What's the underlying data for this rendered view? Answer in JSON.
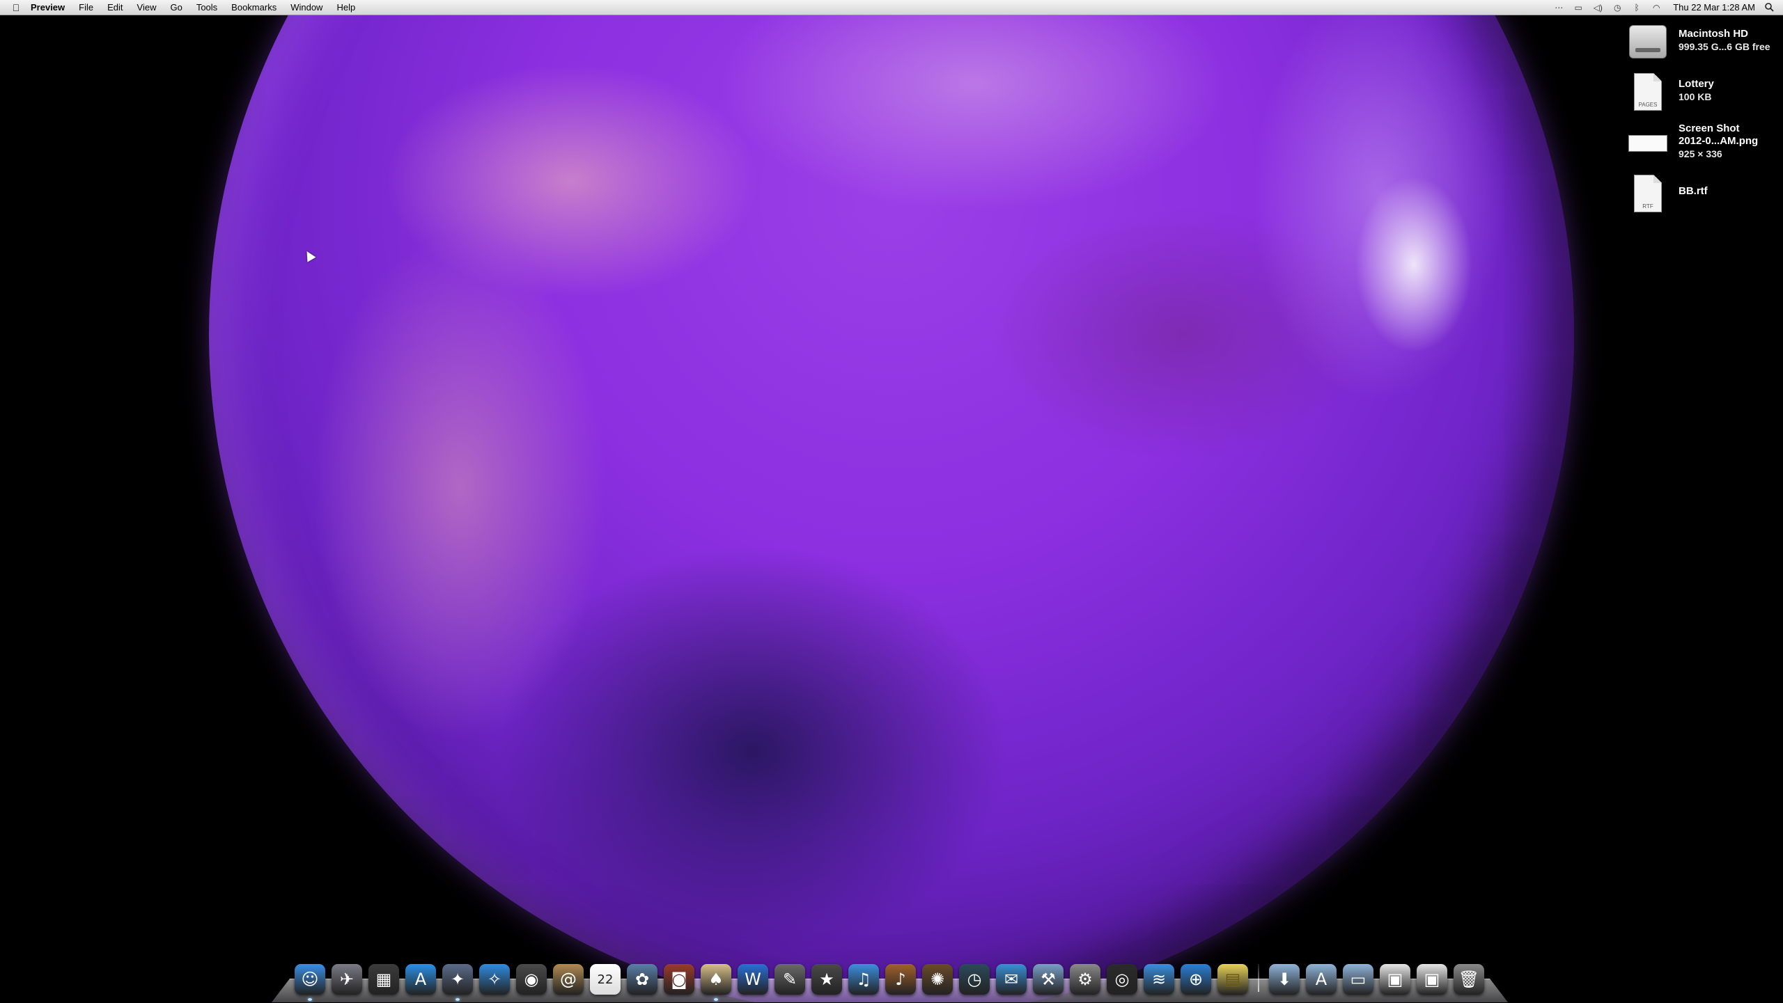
{
  "menubar": {
    "app_name": "Preview",
    "menus": [
      "File",
      "Edit",
      "View",
      "Go",
      "Tools",
      "Bookmarks",
      "Window",
      "Help"
    ],
    "clock": "Thu 22 Mar  1:28 AM"
  },
  "desktop_icons": [
    {
      "name": "Macintosh HD",
      "sub": "999.35 G...6 GB free",
      "icon": "hard-drive-icon"
    },
    {
      "name": "Lottery",
      "sub": "100 KB",
      "icon": "pages-document-icon",
      "tag": "PAGES"
    },
    {
      "name": "Screen Shot",
      "name2": "2012-0...AM.png",
      "sub": "925 × 336",
      "icon": "image-file-icon"
    },
    {
      "name": "BB.rtf",
      "sub": "",
      "icon": "rtf-document-icon",
      "tag": "RTF"
    }
  ],
  "dock": {
    "apps": [
      {
        "id": "finder",
        "icon": "finder-icon",
        "glyph": "☺",
        "color": "#3a8ee6",
        "running": true
      },
      {
        "id": "launchpad",
        "icon": "launchpad-icon",
        "glyph": "✈",
        "color": "#7b7b86",
        "running": false
      },
      {
        "id": "mission-control",
        "icon": "mission-control-icon",
        "glyph": "▦",
        "color": "#3b3b3b",
        "running": false
      },
      {
        "id": "app-store",
        "icon": "app-store-icon",
        "glyph": "A",
        "color": "#2b8fe6",
        "running": false
      },
      {
        "id": "preview",
        "icon": "preview-icon",
        "glyph": "✦",
        "color": "#5b6c8a",
        "running": true
      },
      {
        "id": "safari",
        "icon": "safari-icon",
        "glyph": "✧",
        "color": "#2f8be0",
        "running": false
      },
      {
        "id": "facetime",
        "icon": "facetime-icon",
        "glyph": "◉",
        "color": "#4a4a4a",
        "running": false
      },
      {
        "id": "address-book",
        "icon": "address-book-icon",
        "glyph": "@",
        "color": "#b08a52",
        "running": false
      },
      {
        "id": "ical",
        "icon": "ical-icon",
        "glyph": "22",
        "color": "#e94b4b",
        "running": false
      },
      {
        "id": "iphoto",
        "icon": "iphoto-icon",
        "glyph": "✿",
        "color": "#5a7fa8",
        "running": false
      },
      {
        "id": "photo-booth",
        "icon": "photo-booth-icon",
        "glyph": "◙",
        "color": "#9a3b2b",
        "running": false
      },
      {
        "id": "solitaire",
        "icon": "solitaire-icon",
        "glyph": "♠",
        "color": "#d9c08a",
        "running": true
      },
      {
        "id": "word",
        "icon": "word-icon",
        "glyph": "W",
        "color": "#2a6fd6",
        "running": false
      },
      {
        "id": "script-editor",
        "icon": "script-editor-icon",
        "glyph": "✎",
        "color": "#6a6a6a",
        "running": false
      },
      {
        "id": "imovie",
        "icon": "imovie-icon",
        "glyph": "★",
        "color": "#4a4a4a",
        "running": false
      },
      {
        "id": "itunes",
        "icon": "itunes-icon",
        "glyph": "♫",
        "color": "#3c8fe0",
        "running": false
      },
      {
        "id": "garageband",
        "icon": "garageband-icon",
        "glyph": "♪",
        "color": "#a0622b",
        "running": false
      },
      {
        "id": "pinata",
        "icon": "pinata-icon",
        "glyph": "✺",
        "color": "#6b4b2b",
        "running": false
      },
      {
        "id": "time-machine",
        "icon": "time-machine-icon",
        "glyph": "◷",
        "color": "#2b4b5b",
        "running": false
      },
      {
        "id": "mail",
        "icon": "mail-icon",
        "glyph": "✉",
        "color": "#3a8fd6",
        "running": false
      },
      {
        "id": "xcode",
        "icon": "xcode-icon",
        "glyph": "⚒",
        "color": "#7a9fc6",
        "running": false
      },
      {
        "id": "system-preferences",
        "icon": "system-preferences-icon",
        "glyph": "⚙",
        "color": "#8a8a8a",
        "running": false
      },
      {
        "id": "aperture",
        "icon": "aperture-icon",
        "glyph": "◎",
        "color": "#2b2b2b",
        "running": false
      },
      {
        "id": "wifi",
        "icon": "wifi-icon",
        "glyph": "≋",
        "color": "#3a8fe0",
        "running": false
      },
      {
        "id": "network",
        "icon": "network-globe-icon",
        "glyph": "⊕",
        "color": "#2b7fd6",
        "running": false
      },
      {
        "id": "stickies",
        "icon": "stickies-icon",
        "glyph": "▤",
        "color": "#e8d25a",
        "running": false
      }
    ],
    "stacks": [
      {
        "id": "downloads",
        "icon": "downloads-folder-icon",
        "glyph": "⬇",
        "color": "#8fb3d9"
      },
      {
        "id": "applications",
        "icon": "applications-folder-icon",
        "glyph": "A",
        "color": "#8fb3d9"
      },
      {
        "id": "documents",
        "icon": "documents-folder-icon",
        "glyph": "▭",
        "color": "#8fb3d9"
      },
      {
        "id": "preview-window",
        "icon": "minimized-window-icon",
        "glyph": "▣",
        "color": "#e6e6e6"
      },
      {
        "id": "preview-window-2",
        "icon": "minimized-window-icon",
        "glyph": "▣",
        "color": "#e6e6e6"
      },
      {
        "id": "trash",
        "icon": "trash-icon",
        "glyph": "🗑",
        "color": "#8a8a8a"
      }
    ]
  }
}
